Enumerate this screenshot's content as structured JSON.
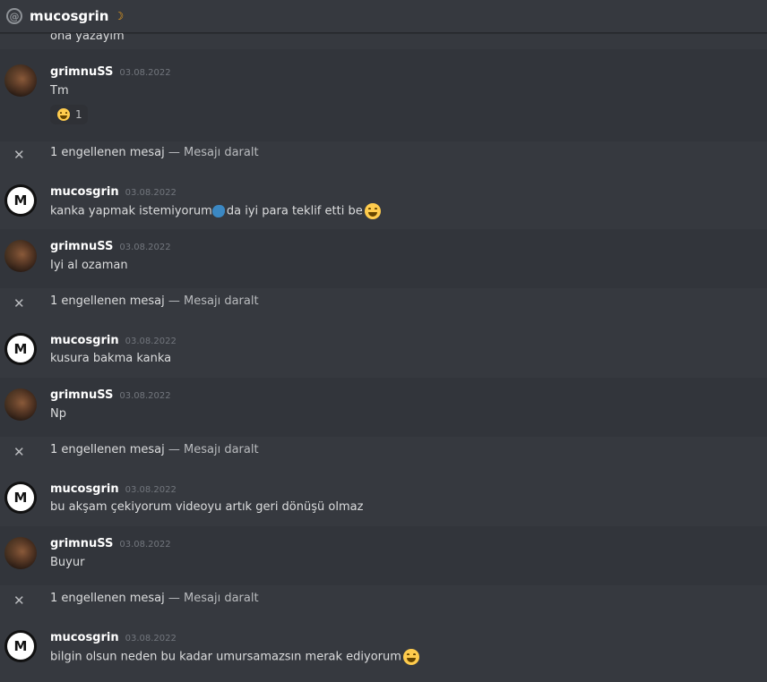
{
  "header": {
    "title": "mucosgrin",
    "status_icon": "moon-icon",
    "leading_icon": "at-icon"
  },
  "partial_message": "ona yazayım",
  "blocked": {
    "count_text": "1 engellenen mesaj",
    "separator": "—",
    "collapse_link": "Mesajı daralt"
  },
  "messages": [
    {
      "author": "grimnuSS",
      "date": "03.08.2022",
      "text": "Tm",
      "reaction": {
        "emoji": "grinning-face",
        "count": "1"
      }
    },
    {
      "author": "mucosgrin",
      "date": "03.08.2022",
      "text": "kanka yapmak istemiyorum",
      "text_after": " da iyi para teklif etti be"
    },
    {
      "author": "grimnuSS",
      "date": "03.08.2022",
      "text": "Iyi al ozaman"
    },
    {
      "author": "mucosgrin",
      "date": "03.08.2022",
      "text": "kusura bakma kanka"
    },
    {
      "author": "grimnuSS",
      "date": "03.08.2022",
      "text": "Np"
    },
    {
      "author": "mucosgrin",
      "date": "03.08.2022",
      "text": "bu akşam çekiyorum videoyu artık geri dönüşü olmaz"
    },
    {
      "author": "grimnuSS",
      "date": "03.08.2022",
      "text": "Buyur"
    },
    {
      "author": "mucosgrin",
      "date": "03.08.2022",
      "text": "bilgin olsun neden bu kadar umursamazsın merak ediyorum"
    }
  ],
  "colors": {
    "background": "#36393f",
    "highlight": "#32353b",
    "timestamp": "#72767d",
    "text": "#dcddde"
  }
}
